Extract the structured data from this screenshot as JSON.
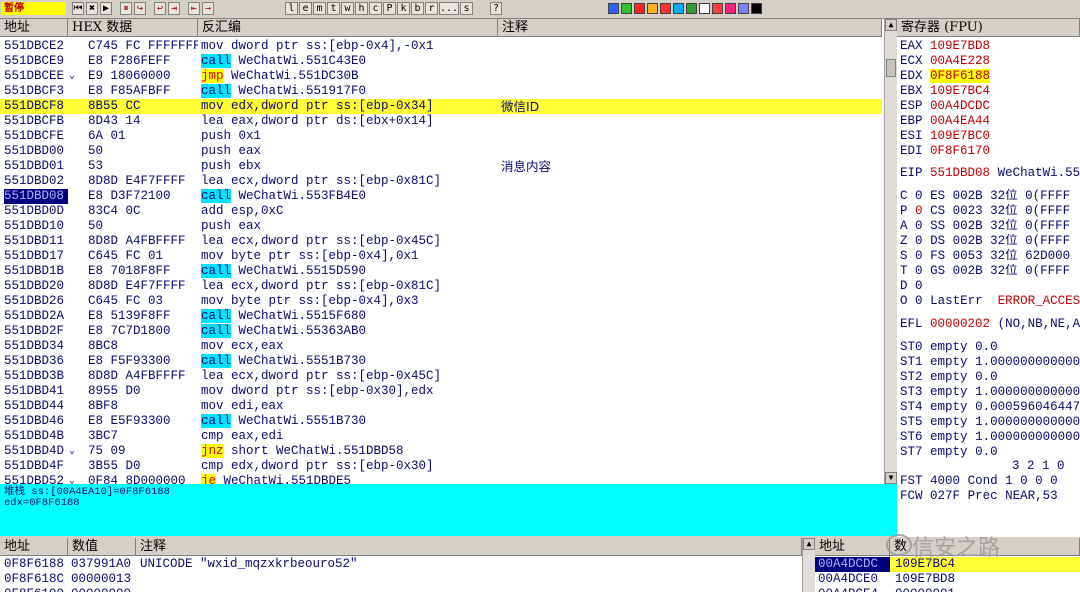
{
  "toolbar": {
    "status": "暂停",
    "buttons": [
      "⏮",
      "✖",
      "▶",
      "⏸",
      "↪",
      "↩",
      "⇥",
      "⇤",
      "→"
    ],
    "letters": [
      "l",
      "e",
      "m",
      "t",
      "w",
      "h",
      "c",
      "P",
      "k",
      "b",
      "r",
      "...",
      "s"
    ],
    "colors": [
      "#3060ff",
      "#30c030",
      "#ff2020",
      "#ffb020",
      "#ff3030",
      "#00b0ff",
      "#30a030",
      "#ffffff",
      "#ff4040",
      "#ff2080",
      "#8080ff",
      "#000000"
    ]
  },
  "disasm": {
    "headers": [
      "地址",
      "HEX 数据",
      "反汇编",
      "注释"
    ],
    "rows": [
      {
        "addr": "551DBCE2",
        "mark": "",
        "hex": "C745 FC FFFFFFFF",
        "asm": "mov dword ptr ss:[ebp-0x4],-0x1",
        "comment": ""
      },
      {
        "addr": "551DBCE9",
        "mark": "",
        "hex": "E8 F286FEFF",
        "kw": "call",
        "asm": " WeChatWi.551C43E0",
        "comment": ""
      },
      {
        "addr": "551DBCEE",
        "mark": "⌄",
        "hex": "E9 18060000",
        "kw": "jmp",
        "asm": " WeChatWi.551DC30B",
        "comment": ""
      },
      {
        "addr": "551DBCF3",
        "mark": "",
        "hex": "E8 F85AFBFF",
        "kw": "call",
        "asm": " WeChatWi.551917F0",
        "comment": ""
      },
      {
        "addr": "551DBCF8",
        "mark": "",
        "hex": "8B55 CC",
        "asm": "mov edx,dword ptr ss:[ebp-0x34]",
        "comment": "微信ID",
        "hl": true
      },
      {
        "addr": "551DBCFB",
        "mark": "",
        "hex": "8D43 14",
        "asm": "lea eax,dword ptr ds:[ebx+0x14]",
        "comment": ""
      },
      {
        "addr": "551DBCFE",
        "mark": "",
        "hex": "6A 01",
        "asm": "push 0x1",
        "comment": ""
      },
      {
        "addr": "551DBD00",
        "mark": "",
        "hex": "50",
        "asm": "push eax",
        "comment": ""
      },
      {
        "addr": "551DBD01",
        "mark": "",
        "hex": "53",
        "asm": "push ebx",
        "comment": "消息内容"
      },
      {
        "addr": "551DBD02",
        "mark": "",
        "hex": "8D8D E4F7FFFF",
        "asm": "lea ecx,dword ptr ss:[ebp-0x81C]",
        "comment": ""
      },
      {
        "addr": "551DBD08",
        "mark": "",
        "hex": "E8 D3F72100",
        "kw": "call",
        "asm": " WeChatWi.553FB4E0",
        "comment": "",
        "sel": true
      },
      {
        "addr": "551DBD0D",
        "mark": "",
        "hex": "83C4 0C",
        "asm": "add esp,0xC",
        "comment": ""
      },
      {
        "addr": "551DBD10",
        "mark": "",
        "hex": "50",
        "asm": "push eax",
        "comment": ""
      },
      {
        "addr": "551DBD11",
        "mark": "",
        "hex": "8D8D A4FBFFFF",
        "asm": "lea ecx,dword ptr ss:[ebp-0x45C]",
        "comment": ""
      },
      {
        "addr": "551DBD17",
        "mark": "",
        "hex": "C645 FC 01",
        "asm": "mov byte ptr ss:[ebp-0x4],0x1",
        "comment": ""
      },
      {
        "addr": "551DBD1B",
        "mark": "",
        "hex": "E8 7018F8FF",
        "kw": "call",
        "asm": " WeChatWi.5515D590",
        "comment": ""
      },
      {
        "addr": "551DBD20",
        "mark": "",
        "hex": "8D8D E4F7FFFF",
        "asm": "lea ecx,dword ptr ss:[ebp-0x81C]",
        "comment": ""
      },
      {
        "addr": "551DBD26",
        "mark": "",
        "hex": "C645 FC 03",
        "asm": "mov byte ptr ss:[ebp-0x4],0x3",
        "comment": ""
      },
      {
        "addr": "551DBD2A",
        "mark": "",
        "hex": "E8 5139F8FF",
        "kw": "call",
        "asm": " WeChatWi.5515F680",
        "comment": ""
      },
      {
        "addr": "551DBD2F",
        "mark": "",
        "hex": "E8 7C7D1800",
        "kw": "call",
        "asm": " WeChatWi.55363AB0",
        "comment": ""
      },
      {
        "addr": "551DBD34",
        "mark": "",
        "hex": "8BC8",
        "asm": "mov ecx,eax",
        "comment": ""
      },
      {
        "addr": "551DBD36",
        "mark": "",
        "hex": "E8 F5F93300",
        "kw": "call",
        "asm": " WeChatWi.5551B730",
        "comment": ""
      },
      {
        "addr": "551DBD3B",
        "mark": "",
        "hex": "8D8D A4FBFFFF",
        "asm": "lea ecx,dword ptr ss:[ebp-0x45C]",
        "comment": ""
      },
      {
        "addr": "551DBD41",
        "mark": "",
        "hex": "8955 D0",
        "asm": "mov dword ptr ss:[ebp-0x30],edx",
        "comment": ""
      },
      {
        "addr": "551DBD44",
        "mark": "",
        "hex": "8BF8",
        "asm": "mov edi,eax",
        "comment": ""
      },
      {
        "addr": "551DBD46",
        "mark": "",
        "hex": "E8 E5F93300",
        "kw": "call",
        "asm": " WeChatWi.5551B730",
        "comment": ""
      },
      {
        "addr": "551DBD4B",
        "mark": "",
        "hex": "3BC7",
        "asm": "cmp eax,edi",
        "comment": ""
      },
      {
        "addr": "551DBD4D",
        "mark": "⌄",
        "hex": "75 09",
        "kw": "jnz",
        "asm": " short WeChatWi.551DBD58",
        "comment": ""
      },
      {
        "addr": "551DBD4F",
        "mark": "",
        "hex": "3B55 D0",
        "asm": "cmp edx,dword ptr ss:[ebp-0x30]",
        "comment": ""
      },
      {
        "addr": "551DBD52",
        "mark": "⌄",
        "hex": "0F84 8D000000",
        "kw": "je",
        "asm": " WeChatWi.551DBDE5",
        "comment": ""
      }
    ]
  },
  "info": {
    "line1": "堆栈 ss:[00A4EA10]=0F8F6188",
    "line2": "edx=0F8F6188"
  },
  "registers": {
    "header": "寄存器 (FPU)",
    "gp": [
      {
        "name": "EAX",
        "value": "109E7BD8"
      },
      {
        "name": "ECX",
        "value": "00A4E228"
      },
      {
        "name": "EDX",
        "value": "0F8F6188",
        "hl": true
      },
      {
        "name": "EBX",
        "value": "109E7BC4"
      },
      {
        "name": "ESP",
        "value": "00A4DCDC"
      },
      {
        "name": "EBP",
        "value": "00A4EA44"
      },
      {
        "name": "ESI",
        "value": "109E7BC0"
      },
      {
        "name": "EDI",
        "value": "0F8F6170"
      }
    ],
    "eip": {
      "name": "EIP",
      "value": "551DBD08",
      "extra": "WeChatWi.55"
    },
    "flags": [
      {
        "flag": "C",
        "val": "0",
        "seg": "ES",
        "sel": "002B",
        "info": "32位 0(FFFF"
      },
      {
        "flag": "P",
        "val": "0",
        "seg": "CS",
        "sel": "0023",
        "info": "32位 0(FFFF",
        "red": true
      },
      {
        "flag": "A",
        "val": "0",
        "seg": "SS",
        "sel": "002B",
        "info": "32位 0(FFFF"
      },
      {
        "flag": "Z",
        "val": "0",
        "seg": "DS",
        "sel": "002B",
        "info": "32位 0(FFFF"
      },
      {
        "flag": "S",
        "val": "0",
        "seg": "FS",
        "sel": "0053",
        "info": "32位 62D000"
      },
      {
        "flag": "T",
        "val": "0",
        "seg": "GS",
        "sel": "002B",
        "info": "32位 0(FFFF"
      },
      {
        "flag": "D",
        "val": "0",
        "seg": "",
        "sel": "",
        "info": ""
      },
      {
        "flag": "O",
        "val": "0",
        "seg": "LastErr",
        "sel": "",
        "info": "ERROR_ACCES"
      }
    ],
    "efl": {
      "name": "EFL",
      "value": "00000202",
      "extra": "(NO,NB,NE,A"
    },
    "fpu": [
      {
        "name": "ST0",
        "state": "empty",
        "value": "0.0"
      },
      {
        "name": "ST1",
        "state": "empty",
        "value": "1.000000000000"
      },
      {
        "name": "ST2",
        "state": "empty",
        "value": "0.0"
      },
      {
        "name": "ST3",
        "state": "empty",
        "value": "1.000000000000"
      },
      {
        "name": "ST4",
        "state": "empty",
        "value": "0.000596046447"
      },
      {
        "name": "ST5",
        "state": "empty",
        "value": "1.000000000000"
      },
      {
        "name": "ST6",
        "state": "empty",
        "value": "1.000000000000"
      },
      {
        "name": "ST7",
        "state": "empty",
        "value": "0.0"
      }
    ],
    "fpu_index": "3 2 1 0",
    "fst": {
      "name": "FST",
      "value": "4000",
      "label": "Cond",
      "bits": "1 0 0 0"
    },
    "fcw": {
      "name": "FCW",
      "value": "027F",
      "label": "Prec",
      "mode": "NEAR,53"
    }
  },
  "dump": {
    "headers": [
      "地址",
      "数值",
      "注释"
    ],
    "rows": [
      {
        "addr": "0F8F6188",
        "value": "037991A0",
        "comment": "UNICODE \"wxid_mqzxkrbeouro52\""
      },
      {
        "addr": "0F8F618C",
        "value": "00000013",
        "comment": ""
      },
      {
        "addr": "0F8F6190",
        "value": "00000000",
        "comment": ""
      }
    ]
  },
  "stack": {
    "headers": [
      "地址",
      "数"
    ],
    "rows": [
      {
        "addr": "00A4DCDC",
        "value": "109E7BC4",
        "hl": true
      },
      {
        "addr": "00A4DCE0",
        "value": "109E7BD8"
      },
      {
        "addr": "00A4DCE4",
        "value": "00000001"
      }
    ]
  },
  "watermark": "信安之路"
}
